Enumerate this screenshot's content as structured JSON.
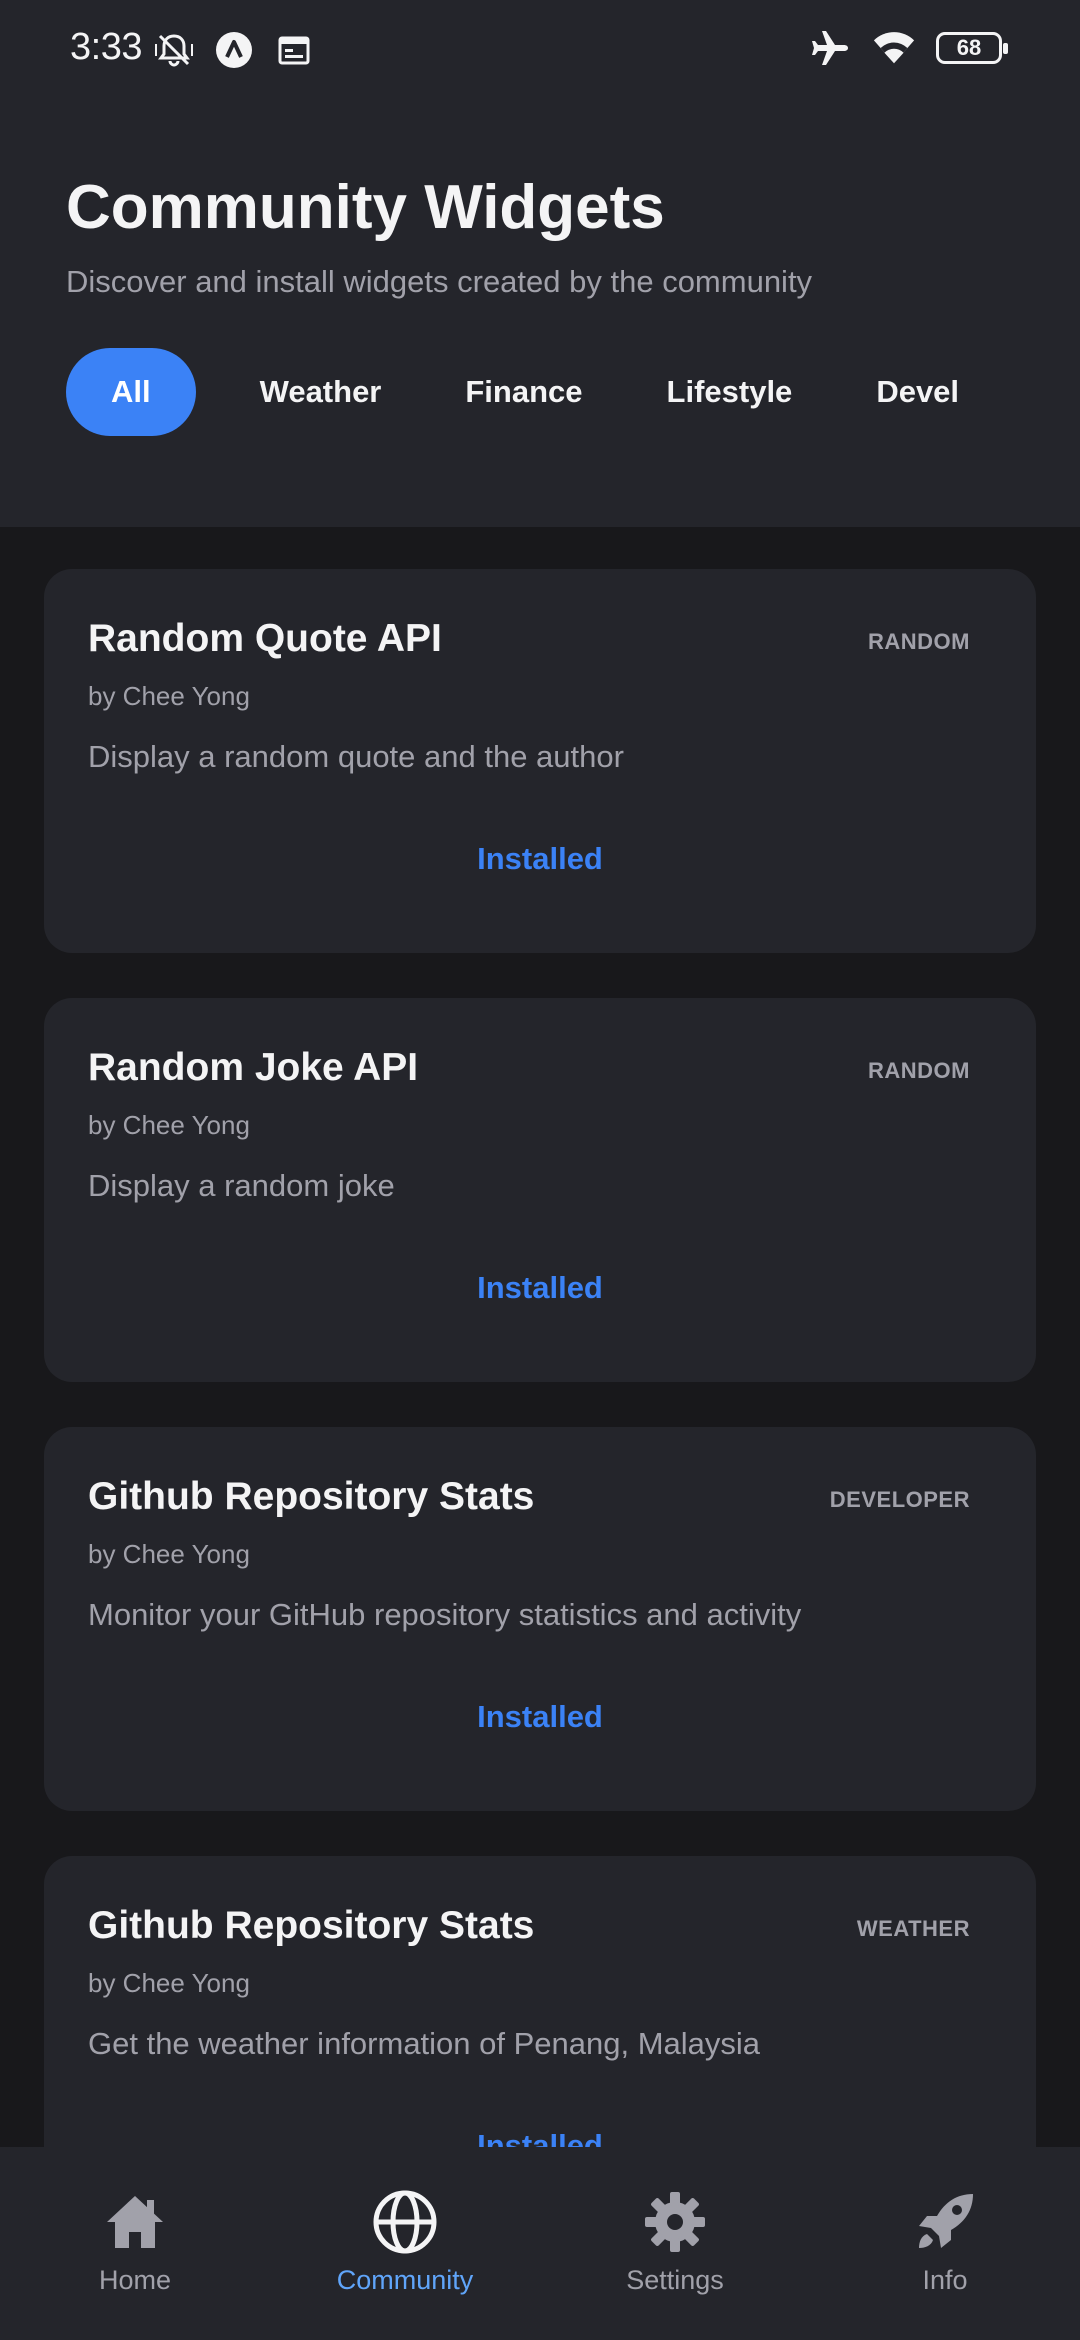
{
  "status_bar": {
    "time": "3:33",
    "battery": "68",
    "left_icons": [
      "mute-vibrate-icon",
      "app-a-icon",
      "calendar-icon"
    ],
    "right_icons": [
      "airplane-icon",
      "wifi-icon",
      "battery-icon"
    ]
  },
  "header": {
    "title": "Community Widgets",
    "subtitle": "Discover and install widgets created by the community"
  },
  "filters": [
    {
      "label": "All",
      "active": true
    },
    {
      "label": "Weather",
      "active": false
    },
    {
      "label": "Finance",
      "active": false
    },
    {
      "label": "Lifestyle",
      "active": false
    },
    {
      "label": "Devel",
      "active": false
    }
  ],
  "cards": [
    {
      "title": "Random Quote API",
      "tag": "RANDOM",
      "author": "by Chee Yong",
      "description": "Display a random quote and the author",
      "action": "Installed"
    },
    {
      "title": "Random Joke API",
      "tag": "RANDOM",
      "author": "by Chee Yong",
      "description": "Display a random joke",
      "action": "Installed"
    },
    {
      "title": "Github Repository Stats",
      "tag": "DEVELOPER",
      "author": "by Chee Yong",
      "description": "Monitor your GitHub repository statistics and activity",
      "action": "Installed"
    },
    {
      "title": "Github Repository Stats",
      "tag": "WEATHER",
      "author": "by Chee Yong",
      "description": "Get the weather information of Penang, Malaysia",
      "action": "Installed"
    }
  ],
  "bottom_nav": [
    {
      "label": "Home",
      "icon": "home-icon",
      "active": false
    },
    {
      "label": "Community",
      "icon": "globe-icon",
      "active": true
    },
    {
      "label": "Settings",
      "icon": "gear-icon",
      "active": false
    },
    {
      "label": "Info",
      "icon": "rocket-icon",
      "active": false
    }
  ],
  "colors": {
    "accent": "#3b82f6",
    "nav_active": "#60a5fa",
    "surface": "#24252b",
    "background": "#18181b",
    "muted_text": "#a1a1aa"
  }
}
